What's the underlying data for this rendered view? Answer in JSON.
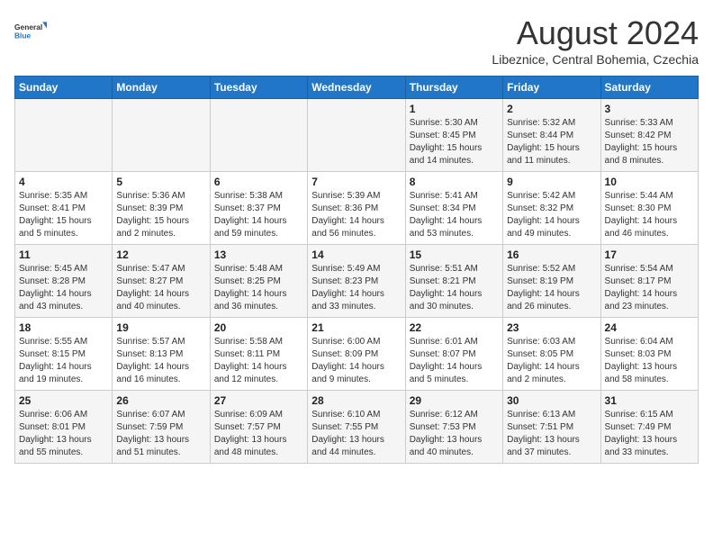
{
  "header": {
    "logo_general": "General",
    "logo_blue": "Blue",
    "main_title": "August 2024",
    "subtitle": "Libeznice, Central Bohemia, Czechia"
  },
  "calendar": {
    "days_of_week": [
      "Sunday",
      "Monday",
      "Tuesday",
      "Wednesday",
      "Thursday",
      "Friday",
      "Saturday"
    ],
    "weeks": [
      [
        {
          "day": "",
          "detail": ""
        },
        {
          "day": "",
          "detail": ""
        },
        {
          "day": "",
          "detail": ""
        },
        {
          "day": "",
          "detail": ""
        },
        {
          "day": "1",
          "detail": "Sunrise: 5:30 AM\nSunset: 8:45 PM\nDaylight: 15 hours\nand 14 minutes."
        },
        {
          "day": "2",
          "detail": "Sunrise: 5:32 AM\nSunset: 8:44 PM\nDaylight: 15 hours\nand 11 minutes."
        },
        {
          "day": "3",
          "detail": "Sunrise: 5:33 AM\nSunset: 8:42 PM\nDaylight: 15 hours\nand 8 minutes."
        }
      ],
      [
        {
          "day": "4",
          "detail": "Sunrise: 5:35 AM\nSunset: 8:41 PM\nDaylight: 15 hours\nand 5 minutes."
        },
        {
          "day": "5",
          "detail": "Sunrise: 5:36 AM\nSunset: 8:39 PM\nDaylight: 15 hours\nand 2 minutes."
        },
        {
          "day": "6",
          "detail": "Sunrise: 5:38 AM\nSunset: 8:37 PM\nDaylight: 14 hours\nand 59 minutes."
        },
        {
          "day": "7",
          "detail": "Sunrise: 5:39 AM\nSunset: 8:36 PM\nDaylight: 14 hours\nand 56 minutes."
        },
        {
          "day": "8",
          "detail": "Sunrise: 5:41 AM\nSunset: 8:34 PM\nDaylight: 14 hours\nand 53 minutes."
        },
        {
          "day": "9",
          "detail": "Sunrise: 5:42 AM\nSunset: 8:32 PM\nDaylight: 14 hours\nand 49 minutes."
        },
        {
          "day": "10",
          "detail": "Sunrise: 5:44 AM\nSunset: 8:30 PM\nDaylight: 14 hours\nand 46 minutes."
        }
      ],
      [
        {
          "day": "11",
          "detail": "Sunrise: 5:45 AM\nSunset: 8:28 PM\nDaylight: 14 hours\nand 43 minutes."
        },
        {
          "day": "12",
          "detail": "Sunrise: 5:47 AM\nSunset: 8:27 PM\nDaylight: 14 hours\nand 40 minutes."
        },
        {
          "day": "13",
          "detail": "Sunrise: 5:48 AM\nSunset: 8:25 PM\nDaylight: 14 hours\nand 36 minutes."
        },
        {
          "day": "14",
          "detail": "Sunrise: 5:49 AM\nSunset: 8:23 PM\nDaylight: 14 hours\nand 33 minutes."
        },
        {
          "day": "15",
          "detail": "Sunrise: 5:51 AM\nSunset: 8:21 PM\nDaylight: 14 hours\nand 30 minutes."
        },
        {
          "day": "16",
          "detail": "Sunrise: 5:52 AM\nSunset: 8:19 PM\nDaylight: 14 hours\nand 26 minutes."
        },
        {
          "day": "17",
          "detail": "Sunrise: 5:54 AM\nSunset: 8:17 PM\nDaylight: 14 hours\nand 23 minutes."
        }
      ],
      [
        {
          "day": "18",
          "detail": "Sunrise: 5:55 AM\nSunset: 8:15 PM\nDaylight: 14 hours\nand 19 minutes."
        },
        {
          "day": "19",
          "detail": "Sunrise: 5:57 AM\nSunset: 8:13 PM\nDaylight: 14 hours\nand 16 minutes."
        },
        {
          "day": "20",
          "detail": "Sunrise: 5:58 AM\nSunset: 8:11 PM\nDaylight: 14 hours\nand 12 minutes."
        },
        {
          "day": "21",
          "detail": "Sunrise: 6:00 AM\nSunset: 8:09 PM\nDaylight: 14 hours\nand 9 minutes."
        },
        {
          "day": "22",
          "detail": "Sunrise: 6:01 AM\nSunset: 8:07 PM\nDaylight: 14 hours\nand 5 minutes."
        },
        {
          "day": "23",
          "detail": "Sunrise: 6:03 AM\nSunset: 8:05 PM\nDaylight: 14 hours\nand 2 minutes."
        },
        {
          "day": "24",
          "detail": "Sunrise: 6:04 AM\nSunset: 8:03 PM\nDaylight: 13 hours\nand 58 minutes."
        }
      ],
      [
        {
          "day": "25",
          "detail": "Sunrise: 6:06 AM\nSunset: 8:01 PM\nDaylight: 13 hours\nand 55 minutes."
        },
        {
          "day": "26",
          "detail": "Sunrise: 6:07 AM\nSunset: 7:59 PM\nDaylight: 13 hours\nand 51 minutes."
        },
        {
          "day": "27",
          "detail": "Sunrise: 6:09 AM\nSunset: 7:57 PM\nDaylight: 13 hours\nand 48 minutes."
        },
        {
          "day": "28",
          "detail": "Sunrise: 6:10 AM\nSunset: 7:55 PM\nDaylight: 13 hours\nand 44 minutes."
        },
        {
          "day": "29",
          "detail": "Sunrise: 6:12 AM\nSunset: 7:53 PM\nDaylight: 13 hours\nand 40 minutes."
        },
        {
          "day": "30",
          "detail": "Sunrise: 6:13 AM\nSunset: 7:51 PM\nDaylight: 13 hours\nand 37 minutes."
        },
        {
          "day": "31",
          "detail": "Sunrise: 6:15 AM\nSunset: 7:49 PM\nDaylight: 13 hours\nand 33 minutes."
        }
      ]
    ]
  }
}
